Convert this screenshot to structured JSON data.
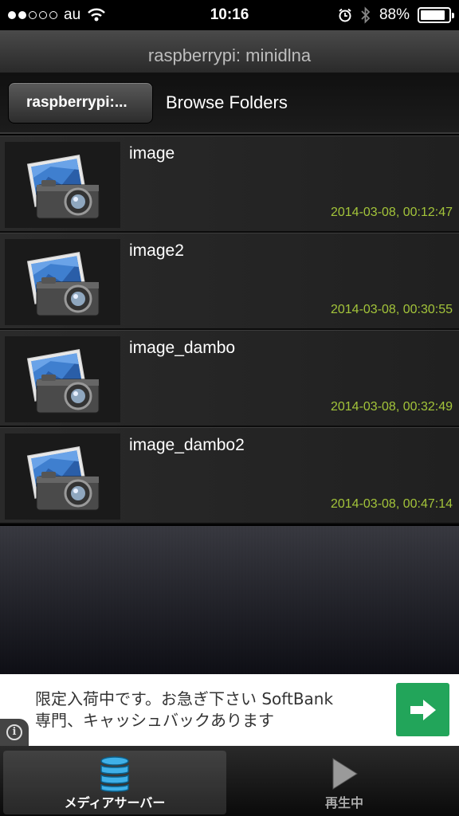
{
  "status_bar": {
    "carrier": "au",
    "time": "10:16",
    "battery_percent": "88%",
    "battery_level": 0.88,
    "signal_bars_filled": 2,
    "signal_bars_total": 5,
    "icons": [
      "signal-icon",
      "wifi-icon",
      "alarm-icon",
      "bluetooth-icon",
      "battery-icon"
    ]
  },
  "app_bar": {
    "title": "raspberrypi: minidlna"
  },
  "nav_bar": {
    "back_label": "raspberrypi:...",
    "title": "Browse Folders"
  },
  "folders": [
    {
      "name": "image",
      "date": "2014-03-08, 00:12:47",
      "icon": "photo-camera-icon"
    },
    {
      "name": "image2",
      "date": "2014-03-08, 00:30:55",
      "icon": "photo-camera-icon"
    },
    {
      "name": "image_dambo",
      "date": "2014-03-08, 00:32:49",
      "icon": "photo-camera-icon"
    },
    {
      "name": "image_dambo2",
      "date": "2014-03-08, 00:47:14",
      "icon": "photo-camera-icon"
    }
  ],
  "ad": {
    "text_line1": "限定入荷中です。お急ぎ下さい SoftBank",
    "text_line2": "専門、キャッシュバックあります",
    "info_icon": "info-icon",
    "arrow_icon": "arrow-right-icon",
    "accent_color": "#22a55a"
  },
  "tab_bar": {
    "tabs": [
      {
        "label": "メディアサーバー",
        "icon": "database-icon",
        "active": true
      },
      {
        "label": "再生中",
        "icon": "play-icon",
        "active": false
      }
    ]
  },
  "colors": {
    "date_text": "#a3c43a",
    "database_icon": "#3fb0e8"
  }
}
